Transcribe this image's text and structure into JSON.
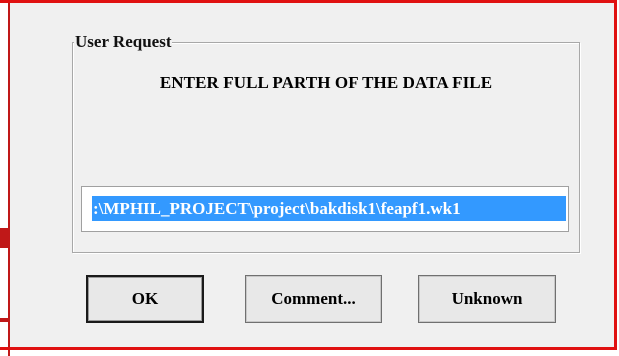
{
  "dialog": {
    "group_title": "User Request",
    "prompt": "ENTER FULL PARTH OF THE DATA FILE",
    "path_value": ":\\MPHIL_PROJECT\\project\\bakdisk1\\feapf1.wk1"
  },
  "buttons": {
    "ok_label": "OK",
    "comment_label": "Comment...",
    "unknown_label": "Unknown"
  },
  "colors": {
    "frame": "#e01010",
    "selection": "#3399ff",
    "dialog_background": "#f0f0f0"
  }
}
